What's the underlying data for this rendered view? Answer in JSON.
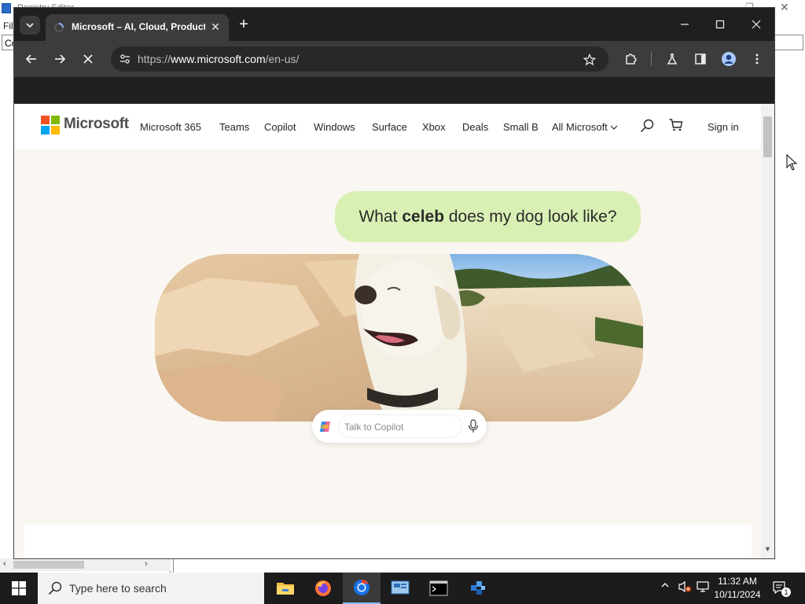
{
  "background_app": {
    "title": "Registry Editor",
    "menu": "File",
    "address": "Computer"
  },
  "browser": {
    "tab": {
      "title": "Microsoft – AI, Cloud, Productivity, Computing, Gaming & Apps"
    },
    "address_bar": {
      "url_prefix": "https://",
      "url_host": "www.microsoft.com",
      "url_path": "/en-us/"
    }
  },
  "page": {
    "brand": "Microsoft",
    "nav_links": [
      "Microsoft 365",
      "Teams",
      "Copilot",
      "Windows",
      "Surface",
      "Xbox",
      "Deals",
      "Small B"
    ],
    "all_microsoft": "All Microsoft",
    "sign_in": "Sign in",
    "hero": {
      "bubble_before": "What ",
      "bubble_bold": "celeb",
      "bubble_after": " does my dog look like?",
      "copilot_placeholder": "Talk to Copilot"
    },
    "colors": {
      "bubble": "#d9f0b4",
      "page_bg": "#faf6f1",
      "ms_red": "#f25022",
      "ms_green": "#7fba00",
      "ms_blue": "#00a4ef",
      "ms_yellow": "#ffb900"
    }
  },
  "taskbar": {
    "search_placeholder": "Type here to search",
    "clock_time": "11:32 AM",
    "clock_date": "10/11/2024",
    "notification_count": "1",
    "apps": [
      "file-explorer-icon",
      "firefox-icon",
      "chrome-icon",
      "control-panel-icon",
      "terminal-icon",
      "registry-editor-icon"
    ]
  }
}
